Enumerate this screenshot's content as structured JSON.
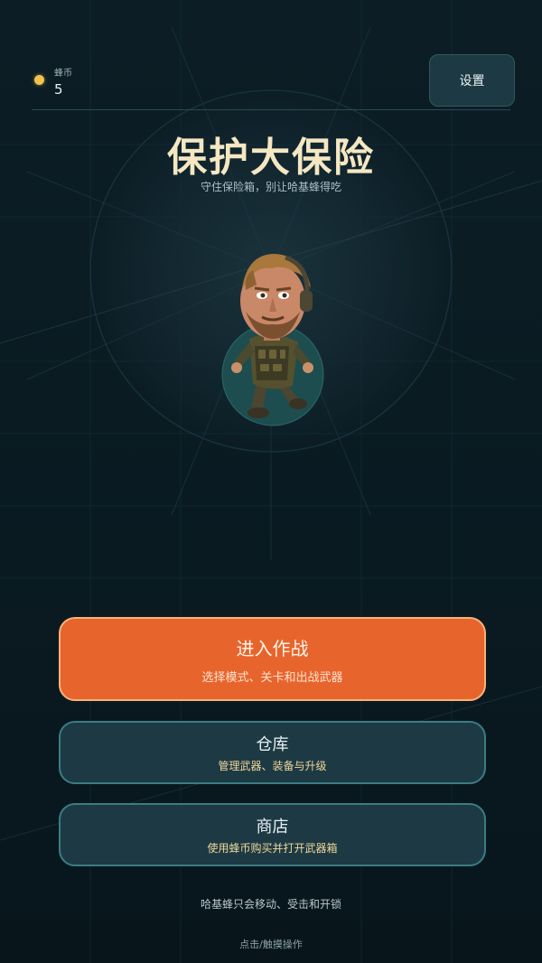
{
  "currency": {
    "label": "蜂币",
    "value": "5"
  },
  "settings": {
    "label": "设置"
  },
  "game": {
    "title": "保护大保险",
    "subtitle": "守住保险箱，别让哈基蜂得吃"
  },
  "character": {
    "icon": "soldier-character"
  },
  "menu": {
    "battle": {
      "label": "进入作战",
      "description": "选择模式、关卡和出战武器"
    },
    "warehouse": {
      "label": "仓库",
      "description": "管理武器、装备与升级"
    },
    "shop": {
      "label": "商店",
      "description": "使用蜂币购买并打开武器箱"
    }
  },
  "footer": {
    "hint": "哈基蜂只会移动、受击和开锁",
    "controls": "点击/触摸操作"
  },
  "colors": {
    "background": "#0b1b22",
    "primary_button": "#e8642d",
    "secondary_button": "#1d3a44",
    "secondary_border": "#3a7d84",
    "title": "#f4e7c2",
    "coin": "#f2c14e"
  }
}
